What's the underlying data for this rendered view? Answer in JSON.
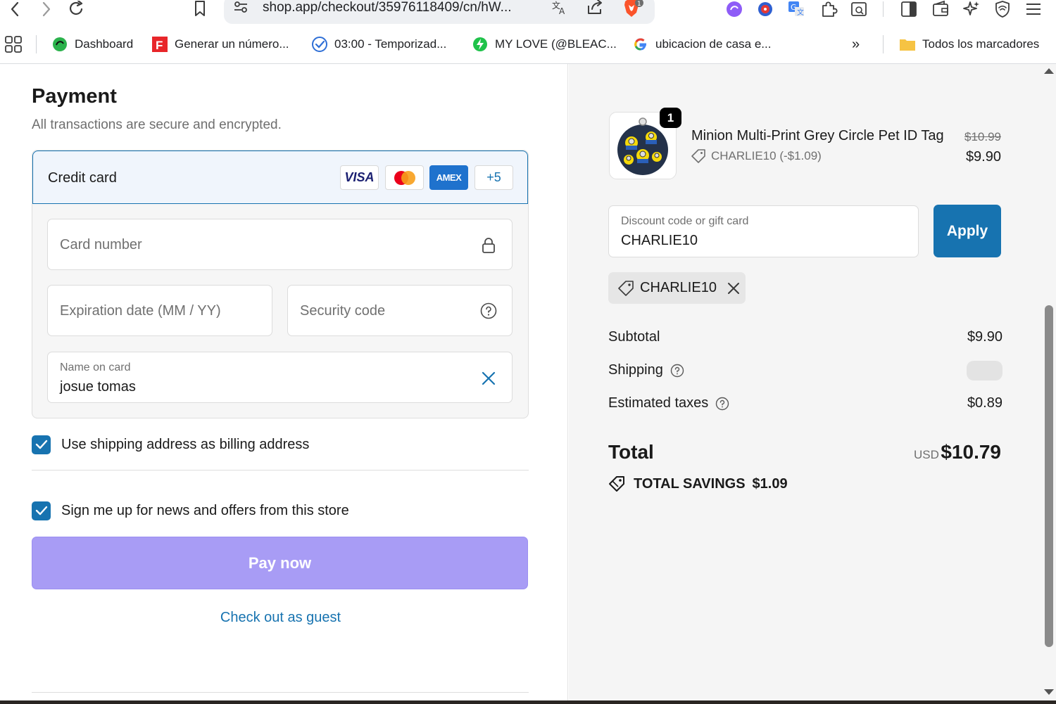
{
  "browser": {
    "url": "shop.app/checkout/35976118409/cn/hW...",
    "bookmarks": [
      {
        "label": "Dashboard"
      },
      {
        "label": "Generar un número..."
      },
      {
        "label": "03:00 - Temporizad..."
      },
      {
        "label": "MY LOVE (@BLEAC..."
      },
      {
        "label": "ubicacion de casa e..."
      }
    ],
    "overflow_label": "»",
    "all_bookmarks": "Todos los marcadores",
    "brave_badge": "1"
  },
  "payment": {
    "title": "Payment",
    "subtitle": "All transactions are secure and encrypted.",
    "method_label": "Credit card",
    "brands": [
      "VISA",
      "AMEX",
      "+5"
    ],
    "card_number_placeholder": "Card number",
    "expiration_placeholder": "Expiration date (MM / YY)",
    "security_placeholder": "Security code",
    "name_label": "Name on card",
    "name_value": "josue tomas",
    "billing_checkbox": {
      "label": "Use shipping address as billing address",
      "checked": true
    },
    "news_checkbox": {
      "label": "Sign me up for news and offers from this store",
      "checked": true
    },
    "pay_button": "Pay now",
    "guest_link": "Check out as guest"
  },
  "summary": {
    "product": {
      "quantity": "1",
      "name": "Minion Multi-Print Grey Circle Pet ID Tag",
      "discount_note": "CHARLIE10 (-$1.09)",
      "original_price": "$10.99",
      "price": "$9.90"
    },
    "discount_field": {
      "label": "Discount code or gift card",
      "value": "CHARLIE10"
    },
    "apply_button": "Apply",
    "applied_code": "CHARLIE10",
    "subtotal_label": "Subtotal",
    "subtotal_value": "$9.90",
    "shipping_label": "Shipping",
    "taxes_label": "Estimated taxes",
    "taxes_value": "$0.89",
    "total_label": "Total",
    "currency": "USD",
    "total_value": "$10.79",
    "savings_label": "TOTAL SAVINGS",
    "savings_value": "$1.09"
  },
  "colors": {
    "accent": "#1773b0",
    "pay_button": "#a89cf5",
    "summary_bg": "#f5f5f5"
  }
}
